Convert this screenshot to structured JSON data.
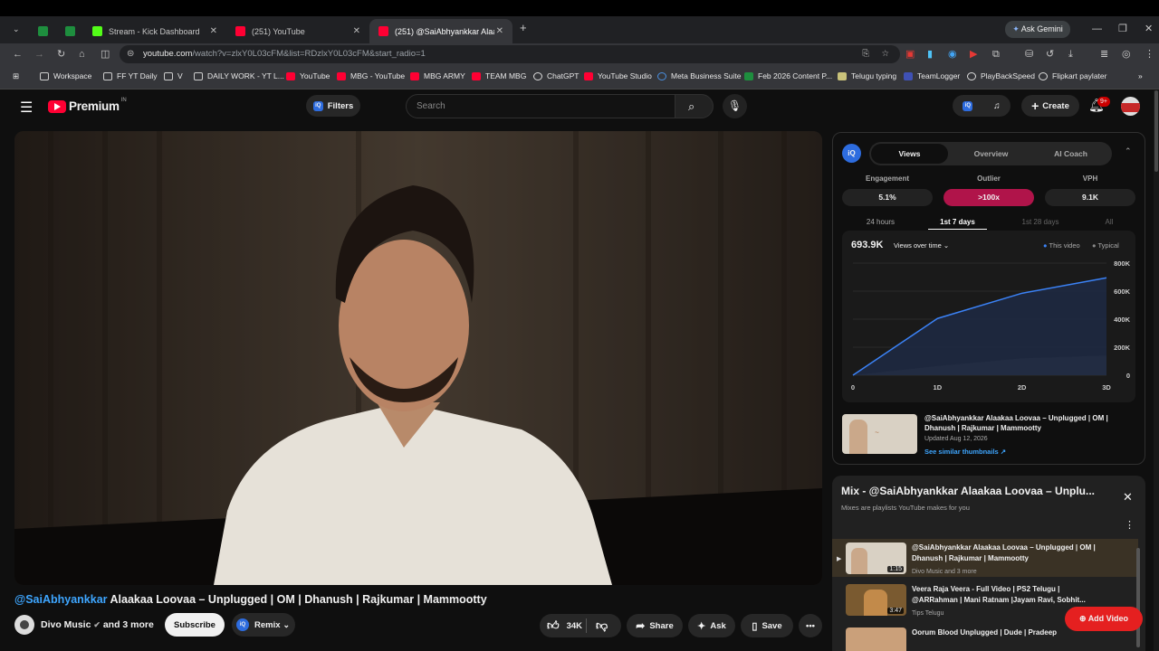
{
  "browser": {
    "tabs": [
      {
        "label": ""
      },
      {
        "label": ""
      },
      {
        "label": "Stream - Kick Dashboard"
      },
      {
        "label": "(251) YouTube"
      },
      {
        "label": "(251) @SaiAbhyankkar Alaakaa"
      }
    ],
    "ask_gemini": "Ask Gemini",
    "url_host": "youtube.com",
    "url_rest": "/watch?v=zlxY0L03cFM&list=RDzlxY0L03cFM&start_radio=1",
    "bookmarks": [
      "Workspace",
      "FF YT Daily",
      "V",
      "DAILY WORK - YT L...",
      "YouTube",
      "MBG - YouTube",
      "MBG ARMY",
      "TEAM MBG",
      "ChatGPT",
      "YouTube Studio",
      "Meta Business Suite",
      "Feb 2026 Content P...",
      "Telugu typing",
      "TeamLogger",
      "PlayBackSpeed",
      "Flipkart paylater"
    ]
  },
  "header": {
    "logo": "Premium",
    "region": "IN",
    "filters": "Filters",
    "search_placeholder": "Search",
    "create": "Create",
    "notif_count": "9+"
  },
  "video": {
    "title_tag": "@SaiAbhyankkar",
    "title_rest": " Alaakaa Loovaa – Unplugged | OM | Dhanush | Rajkumar | Mammootty",
    "channel": "Divo Music",
    "and_more": "and 3 more",
    "subscribe": "Subscribe",
    "remix": "Remix",
    "likes": "34K",
    "share": "Share",
    "ask": "Ask",
    "save": "Save"
  },
  "analytics": {
    "tabs": [
      "Views",
      "Overview",
      "AI Coach"
    ],
    "metric_labels": [
      "Engagement",
      "Outlier",
      "VPH"
    ],
    "metric_values": [
      "5.1%",
      ">100x",
      "9.1K"
    ],
    "ranges": [
      "24 hours",
      "1st 7 days",
      "1st 28 days",
      "All"
    ],
    "total": "693.9K",
    "views_dropdown": "Views over time",
    "legend_this": "This video",
    "legend_typical": "Typical",
    "thumb_title": "@SaiAbhyankkar Alaakaa Loovaa – Unplugged | OM | Dhanush | Rajkumar | Mammootty",
    "updated": "Updated Aug 12, 2026",
    "similar": "See similar thumbnails ↗"
  },
  "chart_data": {
    "type": "area",
    "x": [
      0,
      1,
      2,
      3
    ],
    "x_ticks": [
      "0",
      "1D",
      "2D",
      "3D"
    ],
    "y_ticks": [
      "0",
      "200K",
      "400K",
      "600K",
      "800K"
    ],
    "ylim": [
      0,
      800000
    ],
    "series": [
      {
        "name": "This video",
        "values": [
          0,
          405000,
          585000,
          695000
        ],
        "color": "#3b82f6"
      },
      {
        "name": "Typical",
        "values": [
          0,
          65000,
          120000,
          140000
        ],
        "color": "#8a8a8a"
      }
    ]
  },
  "mix": {
    "title": "Mix - @SaiAbhyankkar Alaakaa Loovaa – Unplu...",
    "subtitle": "Mixes are playlists YouTube makes for you",
    "items": [
      {
        "title": "@SaiAbhyankkar Alaakaa Loovaa – Unplugged | OM | Dhanush | Rajkumar | Mammootty",
        "channel": "Divo Music and 3 more",
        "duration": "1:15"
      },
      {
        "title": "Veera Raja Veera - Full Video | PS2 Telugu | @ARRahman | Mani Ratnam |Jayam Ravi, Sobhit...",
        "channel": "Tips Telugu",
        "duration": "3:47"
      },
      {
        "title": "Oorum Blood Unplugged | Dude | Pradeep",
        "channel": "",
        "duration": ""
      }
    ],
    "add_video": "Add Video"
  }
}
